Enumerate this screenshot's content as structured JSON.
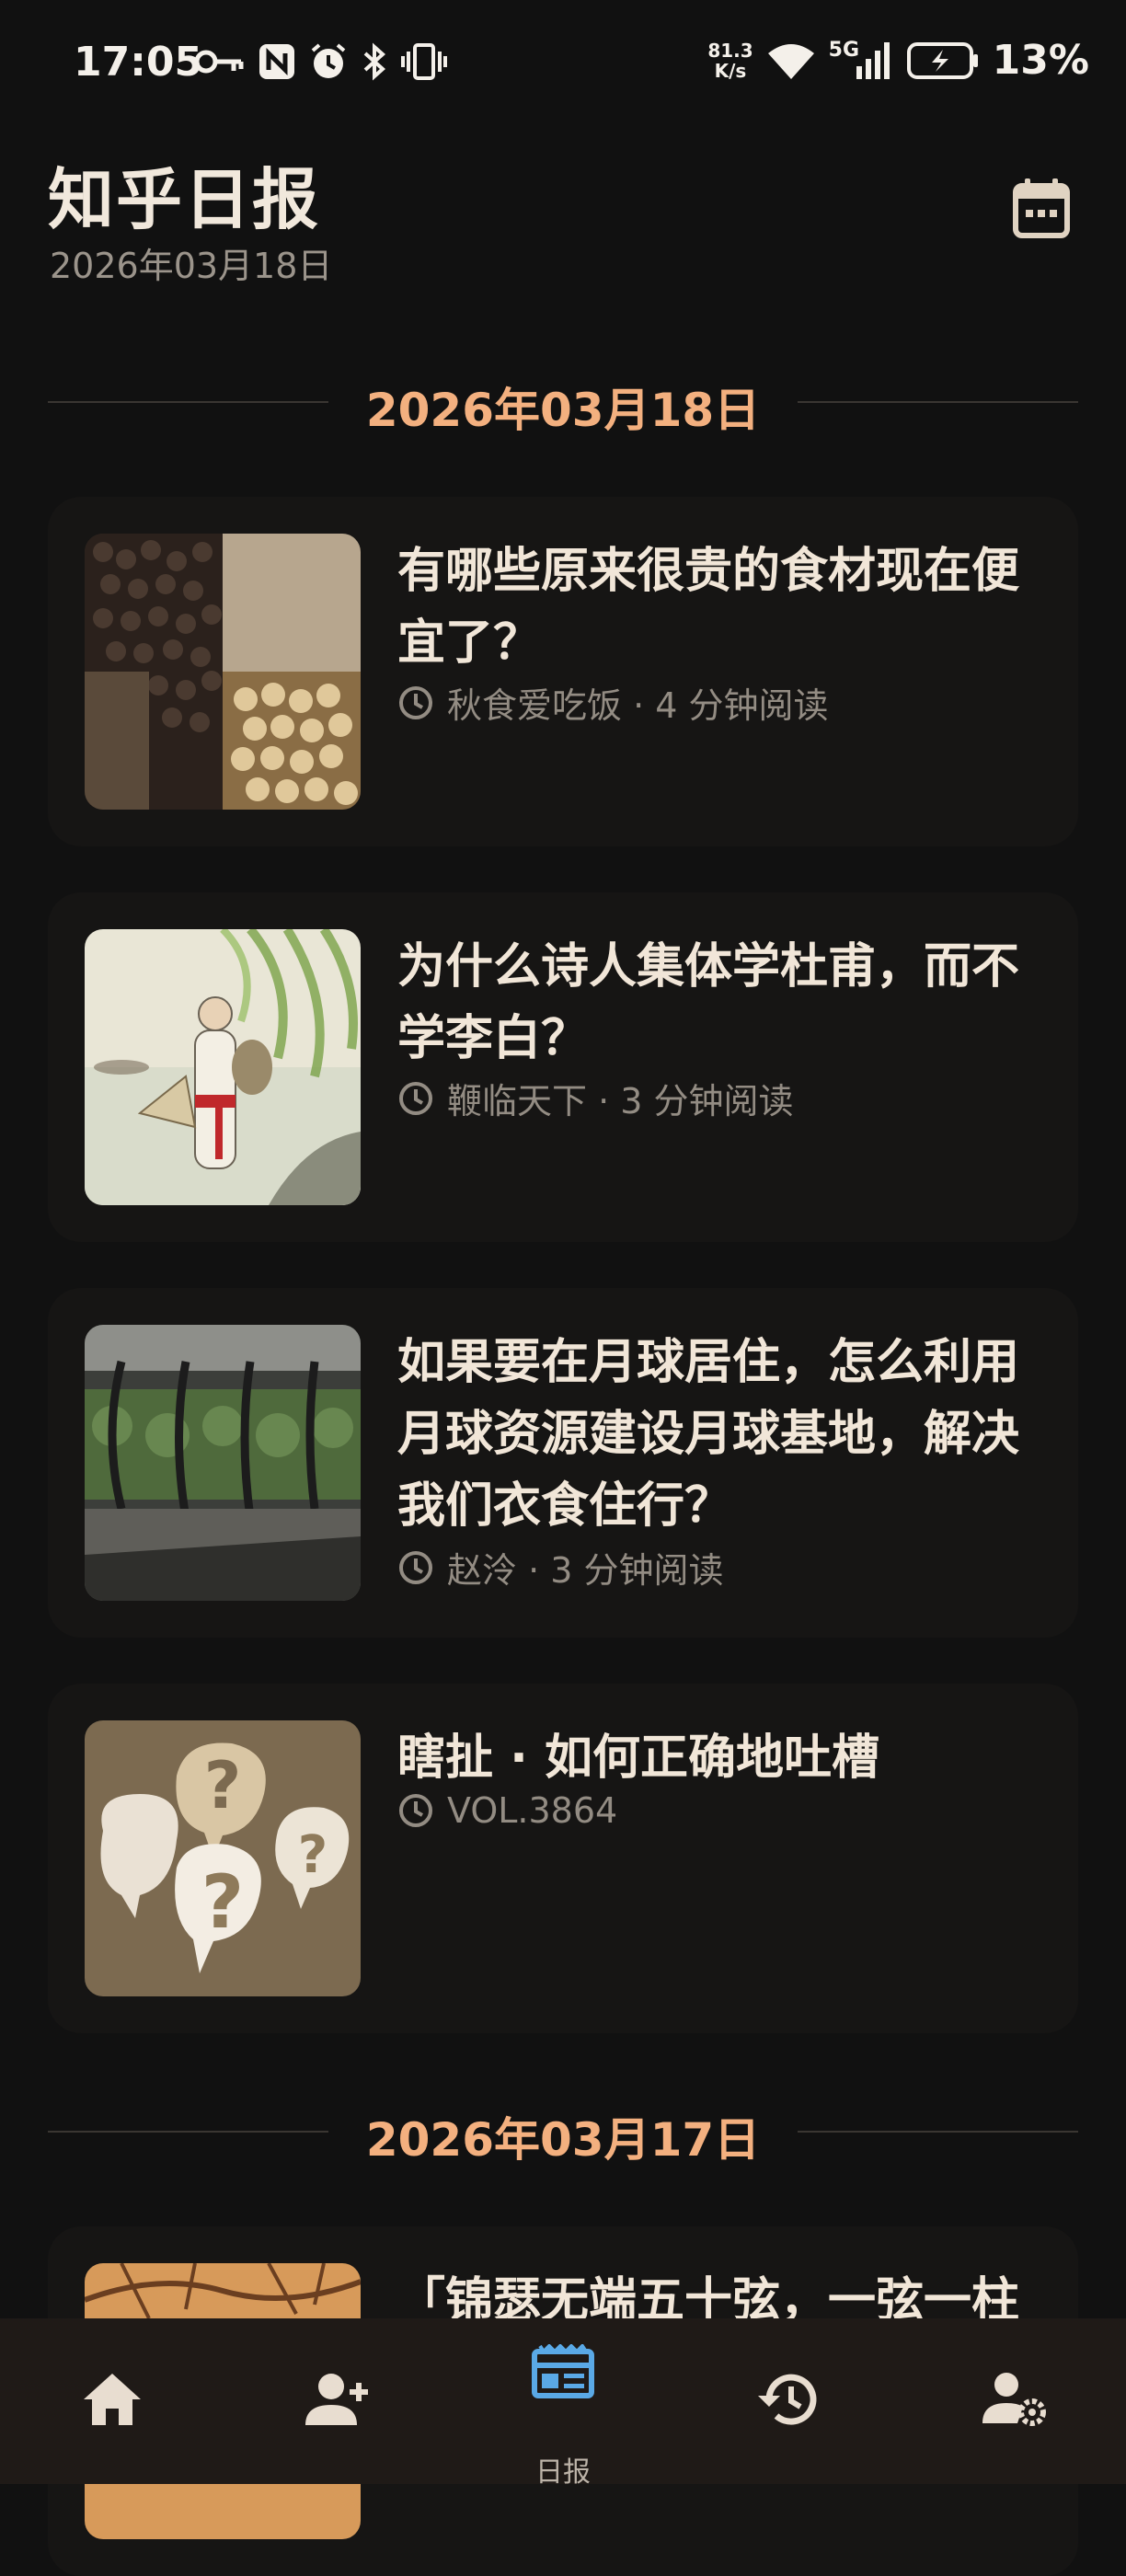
{
  "status_bar": {
    "time": "17:05",
    "net_speed_value": "81.3",
    "net_speed_unit": "K/s",
    "network": "5G",
    "battery": "13%",
    "icons_left": [
      "key-icon",
      "nfc-icon",
      "alarm-icon",
      "bluetooth-icon",
      "vibrate-icon"
    ],
    "icons_right": [
      "wifi-icon",
      "signal-icon",
      "battery-charging-icon"
    ]
  },
  "header": {
    "title": "知乎日报",
    "subtitle": "2026年03月18日",
    "calendar_icon": "calendar-icon"
  },
  "sections": [
    {
      "date": "2026年03月18日",
      "stories": [
        {
          "title": "有哪些原来很贵的食材现在便宜了？",
          "author": "秋食爱吃饭",
          "read_time": "4 分钟阅读",
          "meta": "秋食爱吃饭 · 4 分钟阅读",
          "thumb": "spices"
        },
        {
          "title": "为什么诗人集体学杜甫，而不学李白？",
          "author": "鞭临天下",
          "read_time": "3 分钟阅读",
          "meta": "鞭临天下 · 3 分钟阅读",
          "thumb": "poet"
        },
        {
          "title": "如果要在月球居住，怎么利用月球资源建设月球基地，解决我们衣食住行？",
          "author": "赵泠",
          "read_time": "3 分钟阅读",
          "meta": "赵泠 · 3 分钟阅读",
          "thumb": "greenhouse"
        },
        {
          "title": "瞎扯 · 如何正确地吐槽",
          "meta": "VOL.3864",
          "thumb": "question-marks"
        }
      ]
    },
    {
      "date": "2026年03月17日",
      "stories": [
        {
          "title": "「锦瑟无端五十弦，一弦一柱",
          "thumb": "branches"
        }
      ]
    }
  ],
  "bottom_nav": [
    {
      "icon": "home-icon",
      "label": "",
      "active": false
    },
    {
      "icon": "add-user-icon",
      "label": "",
      "active": false
    },
    {
      "icon": "daily-news-icon",
      "label": "日报",
      "active": true
    },
    {
      "icon": "history-icon",
      "label": "",
      "active": false
    },
    {
      "icon": "user-settings-icon",
      "label": "",
      "active": false
    }
  ],
  "colors": {
    "background": "#111111",
    "card": "#161514",
    "accent_date": "#f3b07f",
    "active_nav": "#5aa9e6",
    "title_text": "#f1e6d8",
    "meta_text": "#938c83",
    "nav_bg": "#1f1a17"
  }
}
